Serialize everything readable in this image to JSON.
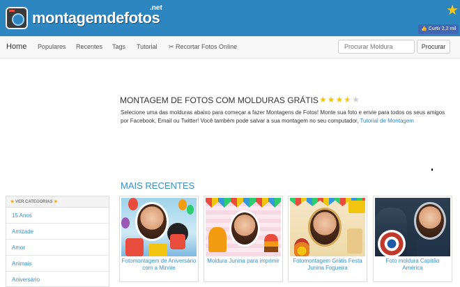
{
  "brand": {
    "name": "montagemdefotos",
    "tld": ".net"
  },
  "facebook": {
    "label": "Curtir 2,2 mil"
  },
  "nav": {
    "items": [
      "Home",
      "Populares",
      "Recentes",
      "Tags",
      "Tutorial"
    ],
    "crop_label": "✂ Recortar Fotos Online"
  },
  "search": {
    "placeholder": "Procurar Moldura",
    "button_label": "Procurar"
  },
  "intro": {
    "title": "MONTAGEM DE FOTOS COM MOLDURAS GRÁTIS",
    "rating_stars": 3.5,
    "text": "Selecione uma das molduras abaixo para começar a fazer Montagens de Fotos! Monte sua foto e envie para todos os seus amigos por Facebook, Email ou Twitter! Você também pode salvar a sua montagem no seu computador,",
    "link_text": "Tutorial de Montagem"
  },
  "categories": {
    "header": "VER CATEGORIAS",
    "items": [
      "15 Anos",
      "Amizade",
      "Amor",
      "Animais",
      "Aniversário"
    ]
  },
  "recent": {
    "title": "MAIS RECENTES",
    "cards": [
      {
        "caption": "Fotomontagem de Aniversário com a Minnie"
      },
      {
        "caption": "Moldura Junina para imprimir"
      },
      {
        "caption": "Fotomontagem Grátis Festa Junina Fogueira"
      },
      {
        "caption": "Foto moldura Capitão América"
      }
    ]
  },
  "colors": {
    "brand_blue": "#2e86c1",
    "link_blue": "#3a8fc7",
    "star_gold": "#f1c40f"
  }
}
